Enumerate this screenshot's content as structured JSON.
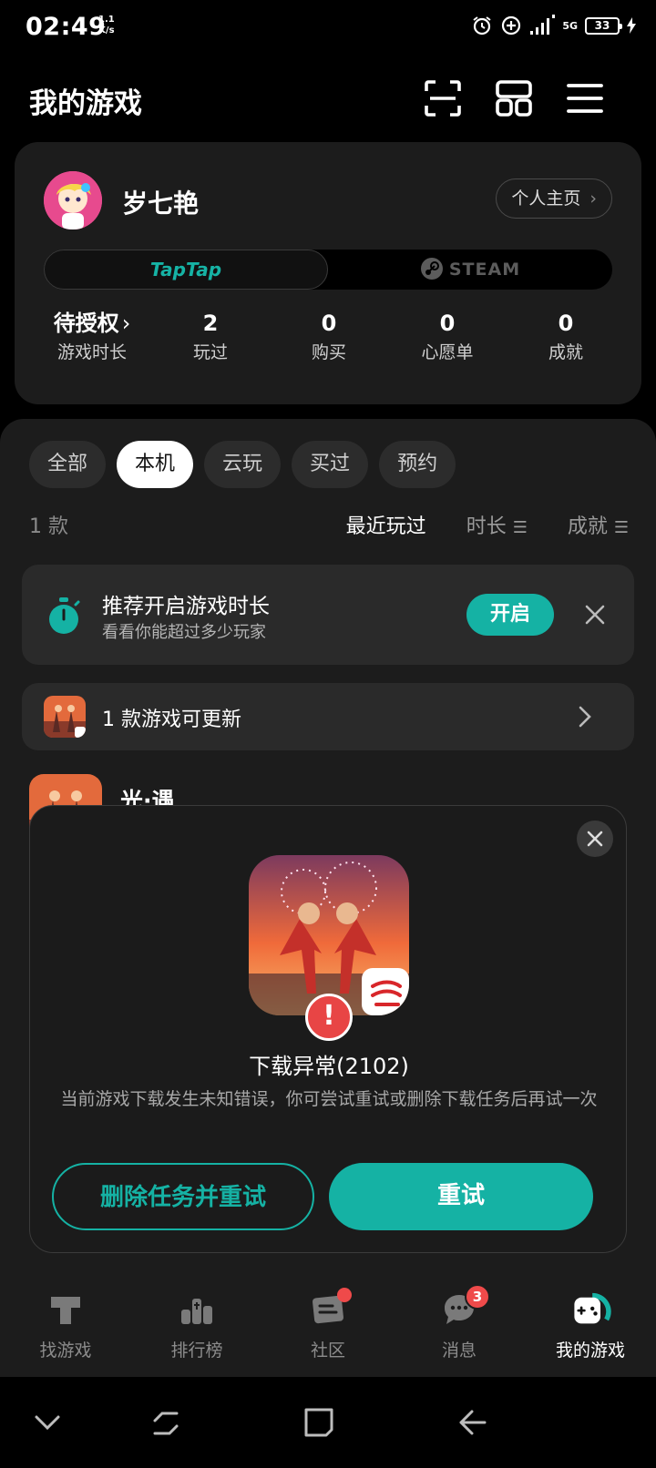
{
  "status_bar": {
    "time": "02:49",
    "net_speed_value": "1.1",
    "net_speed_unit": "K/s",
    "network": "5G",
    "battery": "33"
  },
  "header": {
    "title": "我的游戏",
    "icons": [
      "scan-icon",
      "grid-icon",
      "menu-icon"
    ]
  },
  "profile": {
    "username": "岁七艳",
    "homepage_label": "个人主页",
    "platforms": [
      "TapTap",
      "STEAM"
    ],
    "active_platform": "TapTap",
    "stats": [
      {
        "value": "待授权",
        "label": "游戏时长"
      },
      {
        "value": "2",
        "label": "玩过"
      },
      {
        "value": "0",
        "label": "购买"
      },
      {
        "value": "0",
        "label": "心愿单"
      },
      {
        "value": "0",
        "label": "成就"
      }
    ]
  },
  "filters": {
    "chips": [
      "全部",
      "本机",
      "云玩",
      "买过",
      "预约"
    ],
    "active_chip": "本机",
    "count": "1 款",
    "sorts": [
      "最近玩过",
      "时长",
      "成就"
    ],
    "active_sort": "最近玩过"
  },
  "tip": {
    "title": "推荐开启游戏时长",
    "subtitle": "看看你能超过多少玩家",
    "button": "开启"
  },
  "update": {
    "text": "1 款游戏可更新"
  },
  "game": {
    "name": "光·遇"
  },
  "dialog": {
    "title": "下载异常(2102)",
    "message": "当前游戏下载发生未知错误，你可尝试重试或删除下载任务后再试一次",
    "secondary_button": "删除任务并重试",
    "primary_button": "重试",
    "warning_glyph": "!"
  },
  "tabbar": {
    "tabs": [
      {
        "label": "找游戏",
        "icon": "find-game-icon"
      },
      {
        "label": "排行榜",
        "icon": "ranking-icon"
      },
      {
        "label": "社区",
        "icon": "community-icon"
      },
      {
        "label": "消息",
        "icon": "message-icon"
      },
      {
        "label": "我的游戏",
        "icon": "my-games-icon"
      }
    ],
    "message_badge": "3",
    "active_tab": "我的游戏"
  },
  "colors": {
    "accent": "#15B2A4",
    "badge": "#EF4A4A",
    "background": "#000000",
    "card": "#1C1C1C"
  }
}
